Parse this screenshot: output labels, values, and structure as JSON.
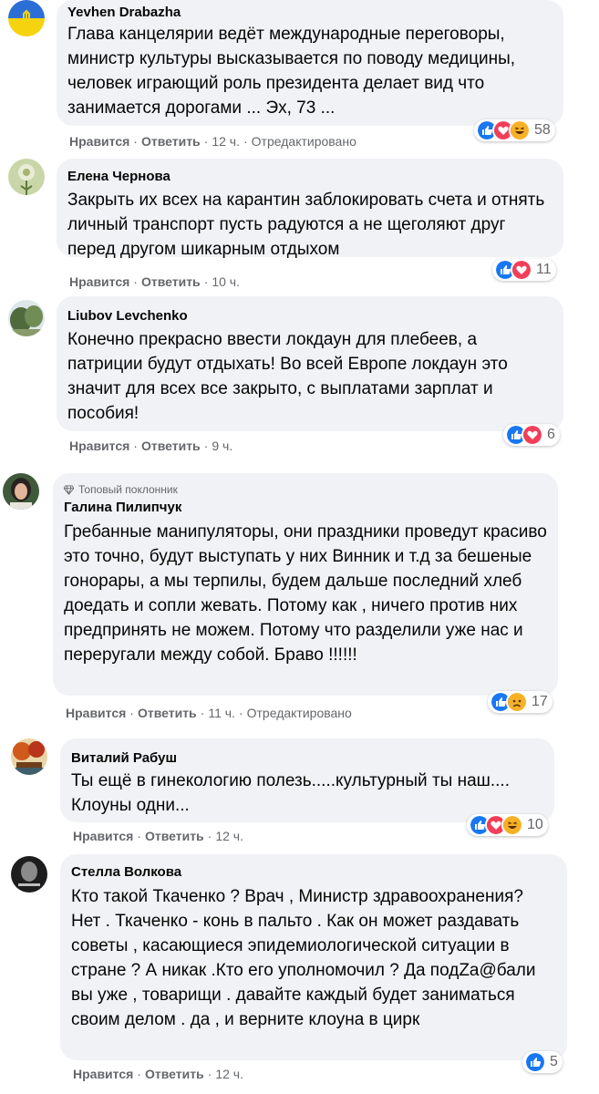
{
  "labels": {
    "like": "Нравится",
    "reply": "Ответить",
    "edited": "Отредактировано",
    "dot": "·"
  },
  "comments": [
    {
      "author": "Yevhen Drabazha",
      "text": "Глава канцелярии ведёт международные переговоры, министр культуры высказывается по поводу медицины, человек играющий роль президента делает вид что занимается дорогами ... Эх, 73 ...",
      "time": "12 ч.",
      "edited": true,
      "reactions": [
        "like",
        "love",
        "haha"
      ],
      "reaction_count": "58"
    },
    {
      "author": "Елена Чернова",
      "text": "Закрыть их всех на карантин заблокировать счета и отнять личный транспорт пусть радуются а не щеголяют друг перед другом шикарным отдыхом",
      "time": "10 ч.",
      "edited": false,
      "reactions": [
        "like",
        "love"
      ],
      "reaction_count": "11"
    },
    {
      "author": "Liubov Levchenko",
      "text": "Конечно прекрасно ввести локдаун для плебеев, а патриции будут отдыхать! Во всей Европе локдаун это значит для всех все закрыто, с выплатами зарплат и пособия!",
      "time": "9 ч.",
      "edited": false,
      "reactions": [
        "like",
        "love"
      ],
      "reaction_count": "6"
    },
    {
      "badge": "Топовый поклонник",
      "author": "Галина Пилипчук",
      "text": "Гребанные манипуляторы, они праздники проведут красиво это точно, будут выступать у них Винник и т.д за бешеные гонорары, а мы терпилы, будем дальше последний хлеб доедать и сопли жевать. Потому как , ничего против них предпринять не можем. Потому что разделили уже нас и переругали между собой. Браво !!!!!!",
      "time": "11 ч.",
      "edited": true,
      "reactions": [
        "like",
        "sad"
      ],
      "reaction_count": "17"
    },
    {
      "author": "Виталий Рабуш",
      "text": "Ты ещё в гинекологию полезь.....культурный ты наш.... Клоуны одни...",
      "time": "12 ч.",
      "edited": false,
      "reactions": [
        "like",
        "love",
        "haha"
      ],
      "reaction_count": "10"
    },
    {
      "author": "Стелла Волкова",
      "text": "Кто такой Ткаченко ? Врач , Министр здравоохранения? Нет . Ткаченко - конь в пальто . Как он может раздавать советы , касающиеся эпидемиологической ситуации в стране ? А никак .Кто его уполномочил ? Да подZa@бали вы уже , товарищи . давайте каждый будет заниматься своим делом . да , и верните клоуна в цирк",
      "time": "12 ч.",
      "edited": false,
      "reactions": [
        "like"
      ],
      "reaction_count": "5"
    }
  ],
  "colors": {
    "bubble": "#f0f2f5",
    "meta": "#65676b",
    "like": "#1877f2",
    "love": "#f33e58",
    "haha": "#f7b125"
  }
}
